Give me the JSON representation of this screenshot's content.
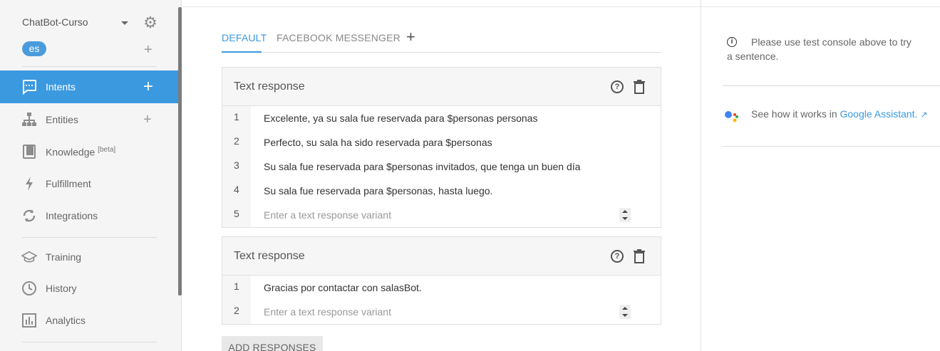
{
  "sidebar": {
    "agent_name": "ChatBot-Curso",
    "language": "es",
    "nav": [
      {
        "label": "Intents",
        "icon": "chat-bubble-icon"
      },
      {
        "label": "Entities",
        "icon": "hierarchy-icon"
      },
      {
        "label": "Knowledge",
        "badge": "[beta]",
        "icon": "book-icon"
      },
      {
        "label": "Fulfillment",
        "icon": "lightning-icon"
      },
      {
        "label": "Integrations",
        "icon": "sync-icon"
      },
      {
        "label": "Training",
        "icon": "graduation-cap-icon"
      },
      {
        "label": "History",
        "icon": "clock-icon"
      },
      {
        "label": "Analytics",
        "icon": "bar-chart-icon"
      }
    ]
  },
  "tabs": {
    "default": "DEFAULT",
    "facebook": "FACEBOOK MESSENGER",
    "add": "+"
  },
  "responses": [
    {
      "title": "Text response",
      "rows": [
        {
          "num": "1",
          "text": "Excelente, ya su sala fue reservada para $personas personas"
        },
        {
          "num": "2",
          "text": "Perfecto, su sala ha sido reservada para $personas"
        },
        {
          "num": "3",
          "text": "Su sala fue reservada para $personas invitados, que tenga un buen día"
        },
        {
          "num": "4",
          "text": "Su sala fue reservada para  $personas, hasta luego."
        },
        {
          "num": "5",
          "placeholder": "Enter a text response variant"
        }
      ]
    },
    {
      "title": "Text response",
      "rows": [
        {
          "num": "1",
          "text": "Gracias por contactar con salasBot."
        },
        {
          "num": "2",
          "placeholder": "Enter a text response variant"
        }
      ]
    }
  ],
  "add_responses_label": "ADD RESPONSES",
  "right_panel": {
    "info_text": "Please use test console above to try a sentence.",
    "ga_prefix": "See how it works in ",
    "ga_link": "Google Assistant."
  },
  "colors": {
    "accent": "#3b99e0",
    "sidebar_bg": "#f5f5f5"
  }
}
